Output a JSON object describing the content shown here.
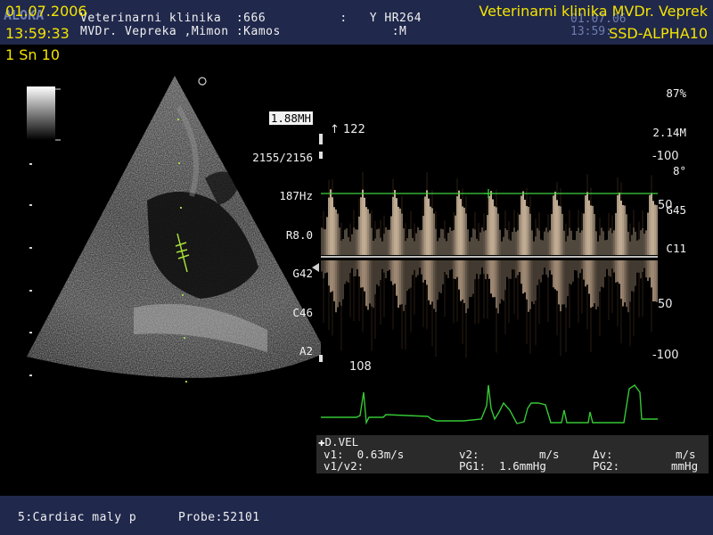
{
  "header": {
    "date": "01.07.2006",
    "time": "13:59:33",
    "mode": "1 Sn 10",
    "clinic_brand": "Veterinarni klinika MVDr. Veprek",
    "model": "SSD-ALPHA10",
    "ghost_logo": "ALOKA",
    "patient_line1": "Veterinarni klinika  :666          :   Y HR264",
    "patient_line2": "MVDr. Vepreka ,Mimon :Kamos               :M",
    "ghost_right1": "01.07.06",
    "ghost_right2": "13:59:"
  },
  "bmode_params": [
    "1.88MH",
    "2155/2156",
    "187Hz",
    "R8.0",
    "G42",
    "C46",
    "A2"
  ],
  "doppler_params": [
    "87%",
    "2.14M",
    "8°",
    "G45",
    "C11"
  ],
  "doppler_scale": {
    "top_label": "↑ 122",
    "ticks": [
      "-100",
      "50",
      "50",
      "-100"
    ]
  },
  "ecg": {
    "heart_rate": "108"
  },
  "measurement": {
    "title": "D.VEL",
    "v1_label": "v1:",
    "v1_value": "0.63m/s",
    "v2_label": "v2:",
    "v2_unit": "m/s",
    "dv_label": "Δv:",
    "dv_unit": "m/s",
    "v1v2_label": "v1/v2:",
    "pg1_label": "PG1:",
    "pg1_value": "1.6mmHg",
    "pg2_label": "PG2:",
    "pg2_unit": "mmHg"
  },
  "footer": {
    "preset": "5:Cardiac maly p",
    "probe": "Probe:52101"
  },
  "colors": {
    "bar": "#20284c",
    "label_yellow": "#f4e400",
    "cursor_green": "#4cd24c",
    "ecg_green": "#36c736"
  }
}
